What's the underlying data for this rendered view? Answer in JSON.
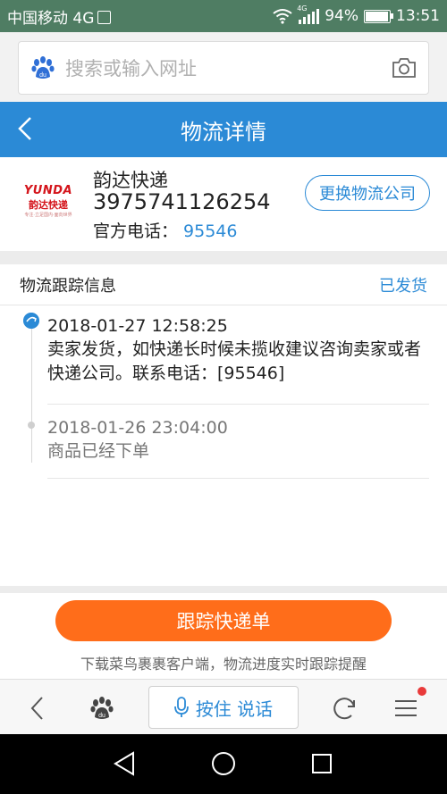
{
  "status_bar": {
    "carrier": "中国移动 4G",
    "network_tag": "4G",
    "battery": "94%",
    "time": "13:51"
  },
  "browser": {
    "search_placeholder": "搜索或输入网址",
    "search_icon": "baidu-paw-icon",
    "camera_icon": "camera-icon"
  },
  "header": {
    "title": "物流详情",
    "back_icon": "chevron-left-icon"
  },
  "carrier_card": {
    "logo_en": "YUNDA",
    "logo_cn": "韵达快递",
    "logo_small": "专注·立足国内·面向世界",
    "name": "韵达快递",
    "tracking_number": "3975741126254",
    "phone_label": "官方电话：",
    "phone_number": "95546",
    "change_button": "更换物流公司"
  },
  "tracking": {
    "title": "物流跟踪信息",
    "status": "已发货",
    "entries": [
      {
        "time": "2018-01-27 12:58:25",
        "desc": "卖家发货，如快递长时候未揽收建议咨询卖家或者快递公司。联系电话：[95546]"
      },
      {
        "time": "2018-01-26 23:04:00",
        "desc": "商品已经下单"
      }
    ]
  },
  "action": {
    "button": "跟踪快递单",
    "hint": "下载菜鸟裹裹客户端，物流进度实时跟踪提醒"
  },
  "toolbar": {
    "voice_label": "按住 说话",
    "icons": [
      "back-icon",
      "baidu-paw-icon",
      "microphone-icon",
      "refresh-icon",
      "menu-icon"
    ]
  },
  "nav": {
    "icons": [
      "back-triangle-icon",
      "home-circle-icon",
      "recents-square-icon"
    ]
  },
  "colors": {
    "accent": "#2b8ad6",
    "status_bar": "#4f7d63",
    "primary_button": "#ff6d1a",
    "brand_red": "#d4141b"
  }
}
